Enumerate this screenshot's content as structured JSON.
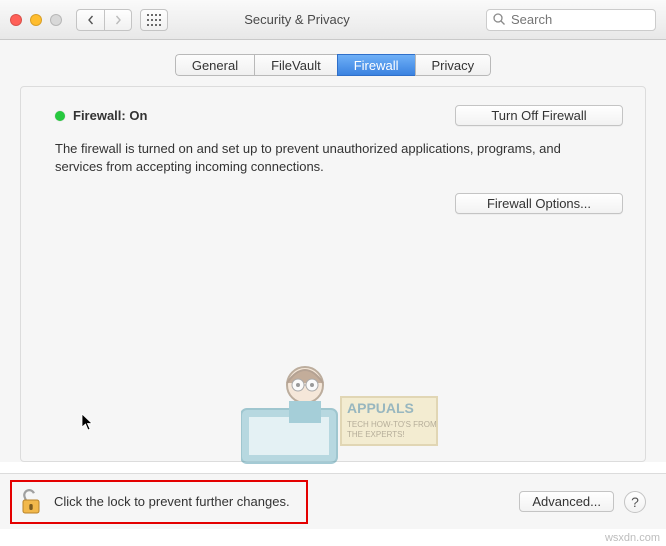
{
  "window": {
    "title": "Security & Privacy"
  },
  "search": {
    "placeholder": "Search",
    "value": ""
  },
  "tabs": {
    "general": "General",
    "filevault": "FileVault",
    "firewall": "Firewall",
    "privacy": "Privacy"
  },
  "firewall": {
    "status_label": "Firewall: On",
    "turn_off_label": "Turn Off Firewall",
    "description": "The firewall is turned on and set up to prevent unauthorized applications, programs, and services from accepting incoming connections.",
    "options_label": "Firewall Options..."
  },
  "lock": {
    "message": "Click the lock to prevent further changes."
  },
  "footer": {
    "advanced_label": "Advanced...",
    "help_glyph": "?"
  },
  "watermark": {
    "brand": "APPUALS",
    "tagline1": "TECH HOW-TO'S FROM",
    "tagline2": "THE EXPERTS!",
    "domain": "wsxdn.com"
  }
}
